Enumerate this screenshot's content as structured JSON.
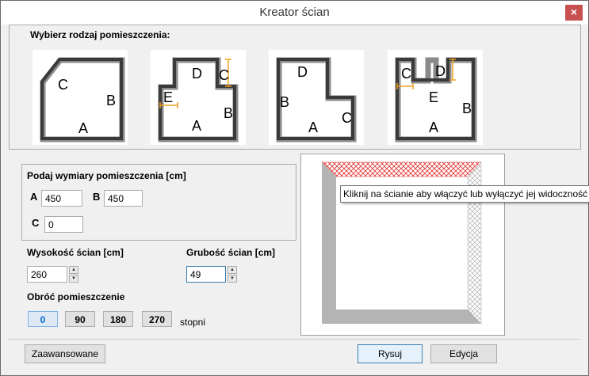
{
  "window": {
    "title": "Kreator ścian",
    "close_glyph": "×"
  },
  "room_type": {
    "label": "Wybierz rodzaj pomieszczenia:",
    "rooms": [
      {
        "labels": [
          "A",
          "B",
          "C"
        ]
      },
      {
        "labels": [
          "A",
          "B",
          "C",
          "D",
          "E"
        ]
      },
      {
        "labels": [
          "A",
          "B",
          "C",
          "D"
        ]
      },
      {
        "labels": [
          "A",
          "B",
          "C",
          "D",
          "E"
        ]
      }
    ]
  },
  "dimensions": {
    "label": "Podaj wymiary pomieszczenia [cm]",
    "a_label": "A",
    "a_value": "450",
    "b_label": "B",
    "b_value": "450",
    "c_label": "C",
    "c_value": "0"
  },
  "wall_height": {
    "label": "Wysokość ścian [cm]",
    "value": "260"
  },
  "wall_thickness": {
    "label": "Grubość ścian [cm]",
    "value": "49"
  },
  "rotation": {
    "label": "Obróć pomieszczenie",
    "options": [
      "0",
      "90",
      "180",
      "270"
    ],
    "selected": "0",
    "unit": "stopni"
  },
  "preview": {
    "tooltip": "Kliknij na ścianie aby włączyć lub wyłączyć jej widoczność",
    "hidden_wall_color": "#e03030",
    "wall_color": "#b4b4b4"
  },
  "buttons": {
    "advanced": "Zaawansowane",
    "draw": "Rysuj",
    "edit": "Edycja"
  },
  "spinner": {
    "up": "▲",
    "down": "▼"
  }
}
